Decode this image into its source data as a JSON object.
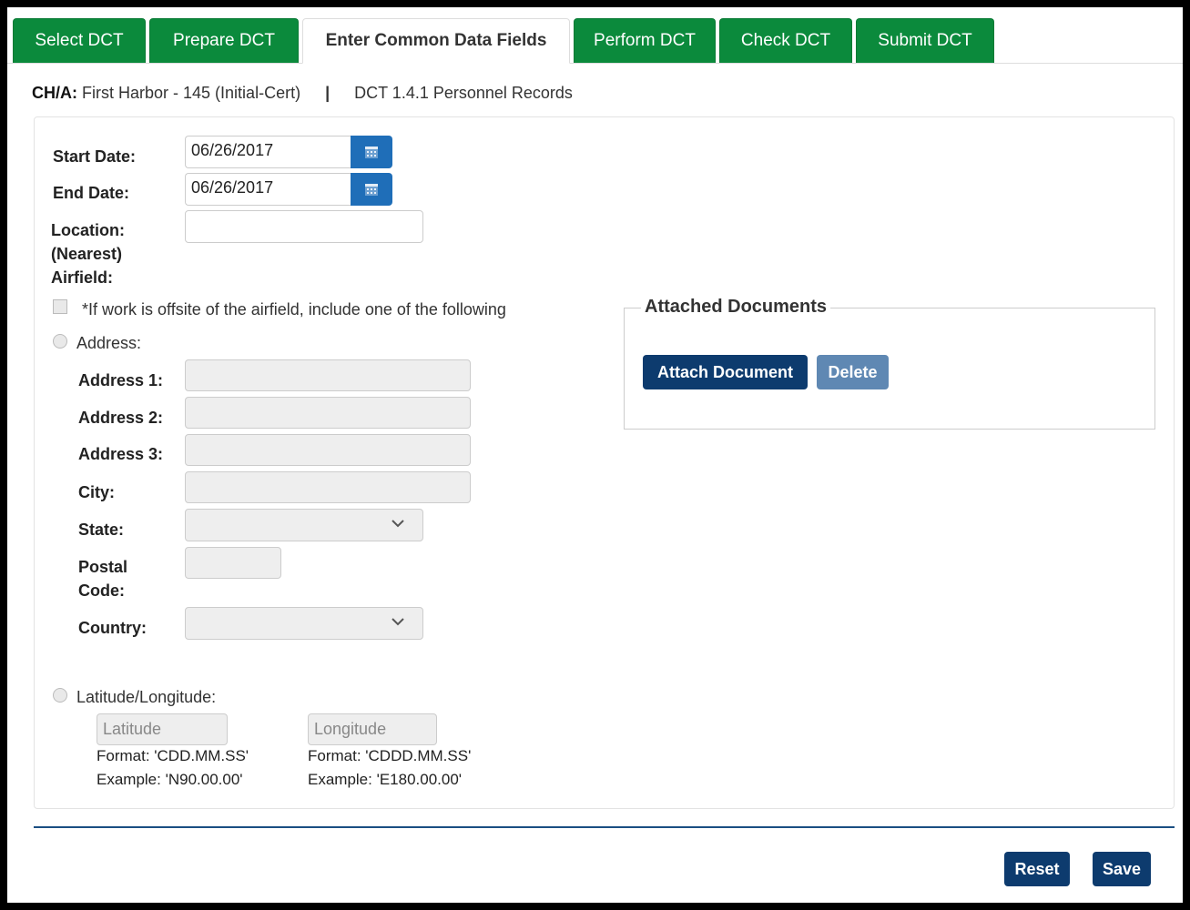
{
  "tabs": [
    {
      "label": "Select DCT"
    },
    {
      "label": "Prepare DCT"
    },
    {
      "label": "Enter Common Data Fields"
    },
    {
      "label": "Perform DCT"
    },
    {
      "label": "Check DCT"
    },
    {
      "label": "Submit DCT"
    }
  ],
  "active_tab": "Enter Common Data Fields",
  "context": {
    "chia_label": "CH/A:",
    "chia_value": "First Harbor - 145 (Initial-Cert)",
    "separator": "|",
    "dct": "DCT 1.4.1 Personnel Records"
  },
  "form": {
    "start_date_label": "Start Date:",
    "start_date_value": "06/26/2017",
    "end_date_label": "End Date:",
    "end_date_value": "06/26/2017",
    "location_label_1": "Location:",
    "location_label_2": "(Nearest)",
    "location_label_3": "Airfield:",
    "location_value": "",
    "offsite_text": "*If work is offsite of the airfield, include one of the following",
    "address_radio_label": "Address:",
    "address1_label": "Address 1:",
    "address2_label": "Address 2:",
    "address3_label": "Address 3:",
    "city_label": "City:",
    "state_label": "State:",
    "postal_label_1": "Postal",
    "postal_label_2": "Code:",
    "country_label": "Country:",
    "latlong_radio_label": "Latitude/Longitude:",
    "latitude_placeholder": "Latitude",
    "longitude_placeholder": "Longitude",
    "lat_format": "Format: 'CDD.MM.SS'",
    "lat_example": "Example: 'N90.00.00'",
    "long_format": "Format: 'CDDD.MM.SS'",
    "long_example": "Example: 'E180.00.00'"
  },
  "attachments": {
    "legend": "Attached Documents",
    "attach_label": "Attach Document",
    "delete_label": "Delete"
  },
  "footer": {
    "reset_label": "Reset",
    "save_label": "Save"
  },
  "colors": {
    "tab_green": "#0b8a3c",
    "calendar_blue": "#1f6eb8",
    "primary_navy": "#0d3b6e",
    "disabled_blue": "#5f88b3"
  }
}
